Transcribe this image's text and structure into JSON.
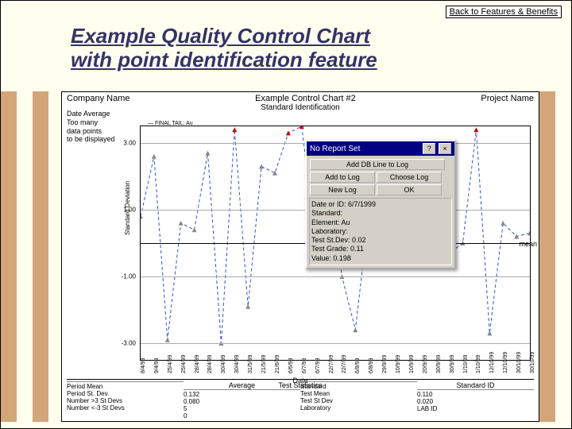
{
  "back_link": "Back to Features & Benefits",
  "page_title_l1": "Example Quality Control Chart",
  "page_title_l2": "with point identification feature",
  "header": {
    "left": "Company Name",
    "center": "Example Control Chart #2",
    "right": "Project Name"
  },
  "subtitle": "Standard Identification",
  "meta": {
    "l1": "Date    Average",
    "l2": "Too many",
    "l3": "data points",
    "l4": "to be displayed"
  },
  "legend": "FINAL TAIL: Au",
  "ylabel": "Standard Deviation",
  "xlabel": "Date",
  "mean_label": "mean",
  "yticks": [
    "3.00",
    "1.00",
    "-1.00",
    "-3.00"
  ],
  "xticks": [
    "8/4/99",
    "9/4/99",
    "25/4/99",
    "25/4/99",
    "28/4/99",
    "28/4/99",
    "30/4/99",
    "30/4/99",
    "31/5/99",
    "21/5/99",
    "21/6/99",
    "6/6/99",
    "6/7/99",
    "6/7/99",
    "22/7/99",
    "22/7/99",
    "6/8/99",
    "6/8/99",
    "29/9/99",
    "10/9/99",
    "10/9/99",
    "20/9/99",
    "30/9/99",
    "30/9/99",
    "1/10/99",
    "1/10/99",
    "12/10/99",
    "12/10/99",
    "30/10/99",
    "30/10/99"
  ],
  "popup": {
    "title": "No Report Set",
    "btn_add_db": "Add DB Line to Log",
    "btn_add": "Add to Log",
    "btn_choose": "Choose Log",
    "btn_new": "New Log",
    "btn_ok": "OK",
    "info1": "Date or ID: 6/7/1999",
    "info2": "Standard:",
    "info3": "Element: Au",
    "info4": "Laboratory:",
    "info5": "Test St.Dev: 0.02",
    "info6": "Test Grade: 0.11",
    "info7": "Value: 0.198"
  },
  "stats_title": "Test Statistics",
  "stats": {
    "col1": {
      "h": "",
      "r1": "Period Mean",
      "r2": "Period St. Dev.",
      "r3": "Number >3 St Devs",
      "r4": "Number <-3 St Devs"
    },
    "col2": {
      "h": "Average",
      "r1": "0.132",
      "r2": "0.080",
      "r3": "5",
      "r4": "0"
    },
    "col3": {
      "h": "",
      "r1": "Standard",
      "r2": "Test Mean",
      "r3": "Test St Dev",
      "r4": "Laboratory"
    },
    "col4": {
      "h": "Standard ID",
      "r1": "0.110",
      "r2": "0.020",
      "r3": "",
      "r4": "LAB ID"
    }
  },
  "chart_data": {
    "type": "line",
    "title": "Example Control Chart #2",
    "ylabel": "Standard Deviation",
    "xlabel": "Date",
    "ylim": [
      -3.5,
      3.5
    ],
    "mean_line": 0,
    "outlier_threshold": 3,
    "categories": [
      "8/4/99",
      "9/4/99",
      "25/4/99",
      "25/4/99",
      "28/4/99",
      "28/4/99",
      "30/4/99",
      "30/4/99",
      "31/5/99",
      "21/5/99",
      "21/6/99",
      "6/6/99",
      "6/7/99",
      "6/7/99",
      "22/7/99",
      "22/7/99",
      "6/8/99",
      "6/8/99",
      "29/9/99",
      "10/9/99",
      "10/9/99",
      "20/9/99",
      "30/9/99",
      "30/9/99",
      "1/10/99",
      "1/10/99",
      "12/10/99",
      "12/10/99",
      "30/10/99",
      "30/10/99"
    ],
    "values": [
      0.8,
      2.6,
      -2.9,
      0.6,
      0.4,
      2.7,
      -3.0,
      3.4,
      -1.9,
      2.3,
      2.1,
      3.3,
      3.5,
      0.2,
      2.6,
      -1.0,
      -2.6,
      0.9,
      0.3,
      0.2,
      0.4,
      -0.2,
      0.1,
      -0.3,
      0.0,
      3.4,
      -2.7,
      0.6,
      0.2,
      0.3
    ],
    "outliers_idx": [
      7,
      11,
      12,
      25
    ]
  }
}
